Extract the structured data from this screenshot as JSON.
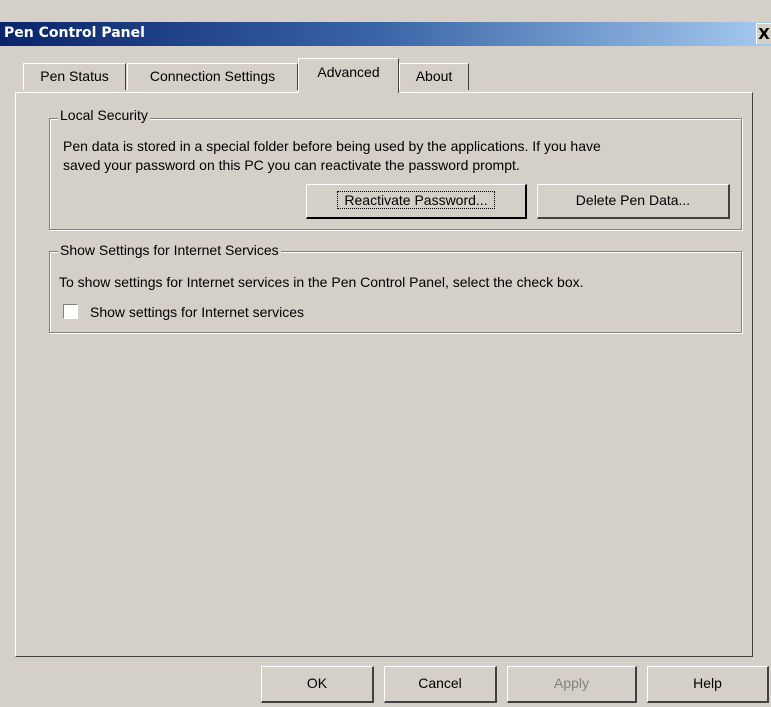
{
  "window": {
    "title": "Pen Control Panel",
    "close_glyph": "X"
  },
  "tabs": [
    {
      "label": "Pen Status"
    },
    {
      "label": "Connection Settings"
    },
    {
      "label": "Advanced",
      "selected": true
    },
    {
      "label": "About"
    }
  ],
  "local_security": {
    "title": "Local Security",
    "line1": "Pen data is stored in a special folder before being used by the applications. If you have",
    "line2": "saved your password on this PC you can reactivate the password prompt.",
    "reactivate_label": "Reactivate Password...",
    "delete_label": "Delete Pen Data..."
  },
  "internet_services": {
    "title": "Show Settings for Internet Services",
    "description": "To show settings for Internet services in the Pen Control Panel, select the check box.",
    "checkbox_label": "Show settings for Internet services",
    "checked": false
  },
  "footer": {
    "ok": "OK",
    "cancel": "Cancel",
    "apply": "Apply",
    "help": "Help"
  },
  "colors": {
    "face": "#d4d0c8",
    "title_start": "#0a246a",
    "title_end": "#a6caf0",
    "disabled_text": "#808080"
  }
}
